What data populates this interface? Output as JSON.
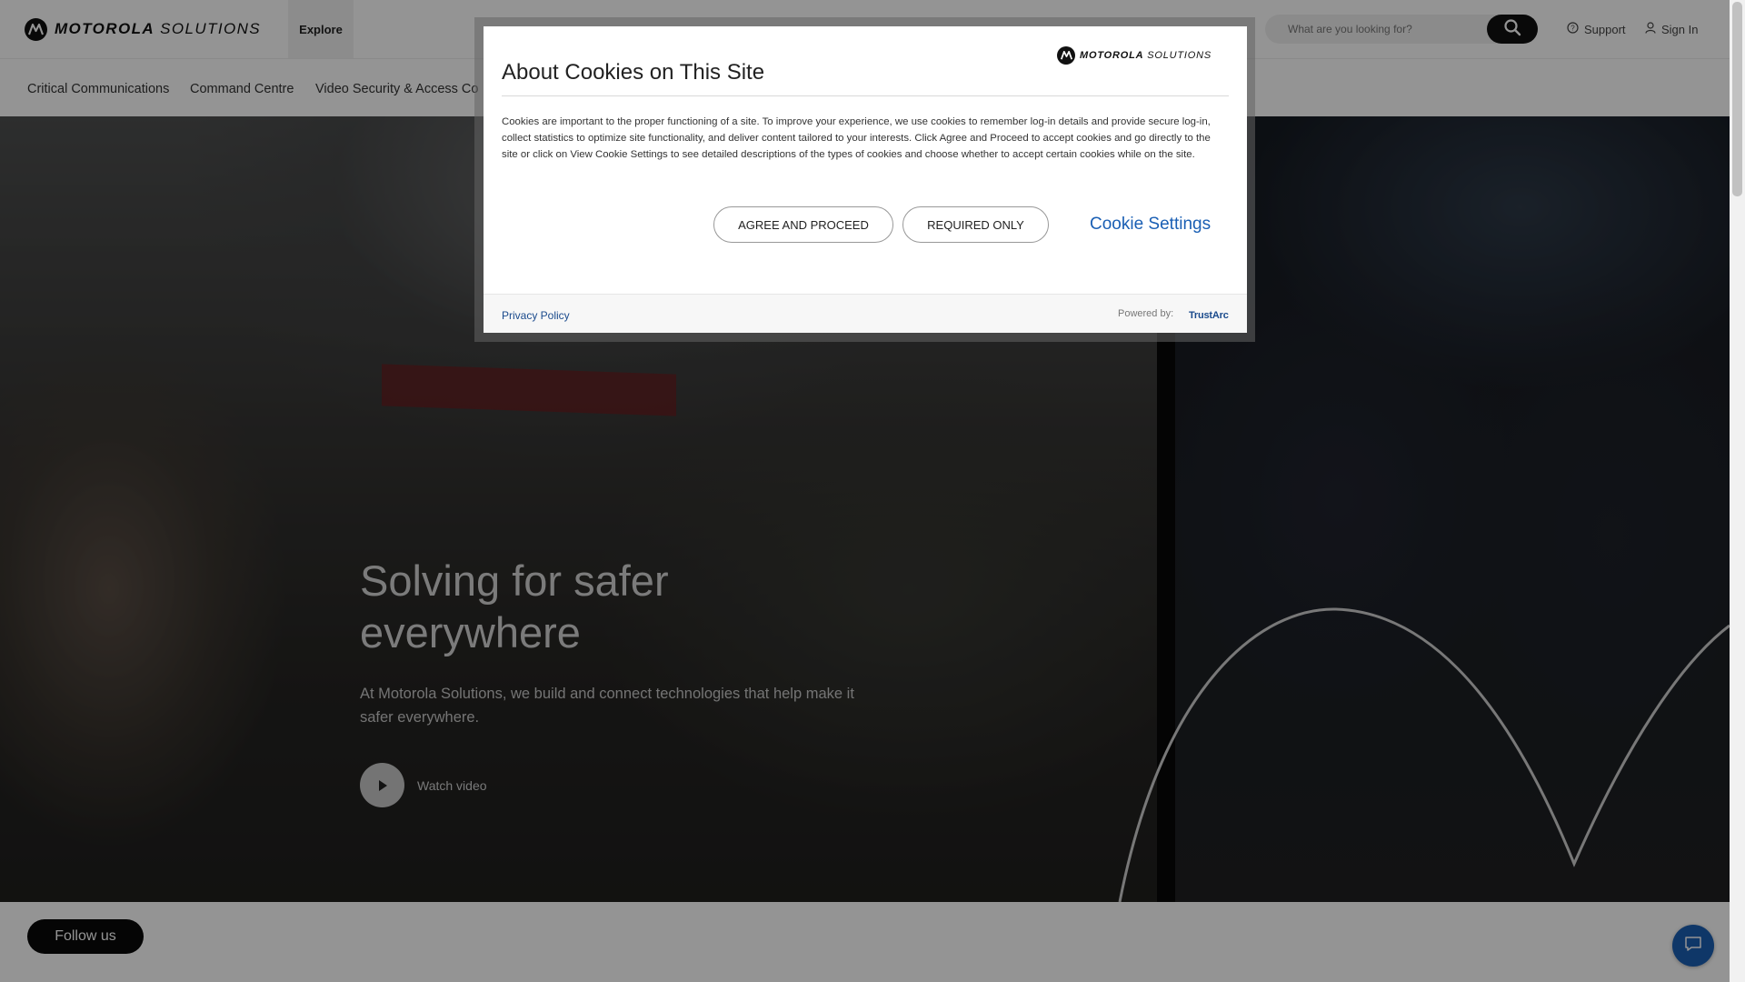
{
  "header": {
    "brand_bold": "MOTOROLA",
    "brand_light": "SOLUTIONS",
    "explore_label": "Explore",
    "search": {
      "placeholder": "What are you looking for?",
      "value": ""
    },
    "support_label": "Support",
    "signin_label": "Sign In"
  },
  "subnav": {
    "items": [
      {
        "label": "Critical Communications"
      },
      {
        "label": "Command Centre"
      },
      {
        "label": "Video Security & Access Co"
      }
    ]
  },
  "hero": {
    "title": "Solving for safer everywhere",
    "description": "At Motorola Solutions, we build and connect technologies that help make it safer everywhere.",
    "watch_label": "Watch video"
  },
  "follow_us_label": "Follow us",
  "cookie_modal": {
    "brand_bold": "MOTOROLA",
    "brand_light": "SOLUTIONS",
    "title": "About Cookies on This Site",
    "body": "Cookies are important to the proper functioning of a site. To improve your experience, we use cookies to remember log-in details and provide secure log-in, collect statistics to optimize site functionality, and deliver content tailored to your interests. Click Agree and Proceed to accept cookies and go directly to the site or click on View Cookie Settings to see detailed descriptions of the types of cookies and choose whether to accept certain cookies while on the site.",
    "agree_label": "AGREE AND PROCEED",
    "required_label": "REQUIRED ONLY",
    "settings_label": "Cookie Settings",
    "privacy_label": "Privacy Policy",
    "powered_by_label": "Powered by:",
    "trustarc_label": "TrustArc"
  },
  "colors": {
    "link_blue": "#1a5fb4",
    "chat_blue": "#1a5fb4",
    "follow_bg": "#0a0a0a"
  },
  "icons": [
    "motorola-logo-icon",
    "search-icon",
    "help-circle-icon",
    "user-icon",
    "play-icon",
    "chat-icon"
  ]
}
